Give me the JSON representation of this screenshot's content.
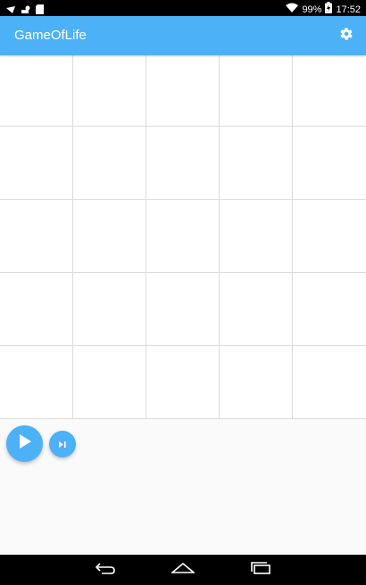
{
  "status_bar": {
    "battery_percent": "99%",
    "time": "17:52",
    "icons": [
      "notification-icon",
      "mail-icon",
      "sdcard-icon",
      "wifi-icon",
      "battery-icon"
    ]
  },
  "app_bar": {
    "title": "GameOfLife",
    "action_icon": "gear-icon"
  },
  "grid": {
    "rows": 5,
    "columns": 5,
    "alive_cells": []
  },
  "controls": {
    "play_icon": "play-icon",
    "step_icon": "skip-next-icon"
  },
  "nav_bar": {
    "buttons": [
      "back-icon",
      "home-icon",
      "recents-icon"
    ]
  },
  "colors": {
    "primary": "#4db1f8",
    "grid_line": "#dcdcdc",
    "background": "#fafafa"
  }
}
